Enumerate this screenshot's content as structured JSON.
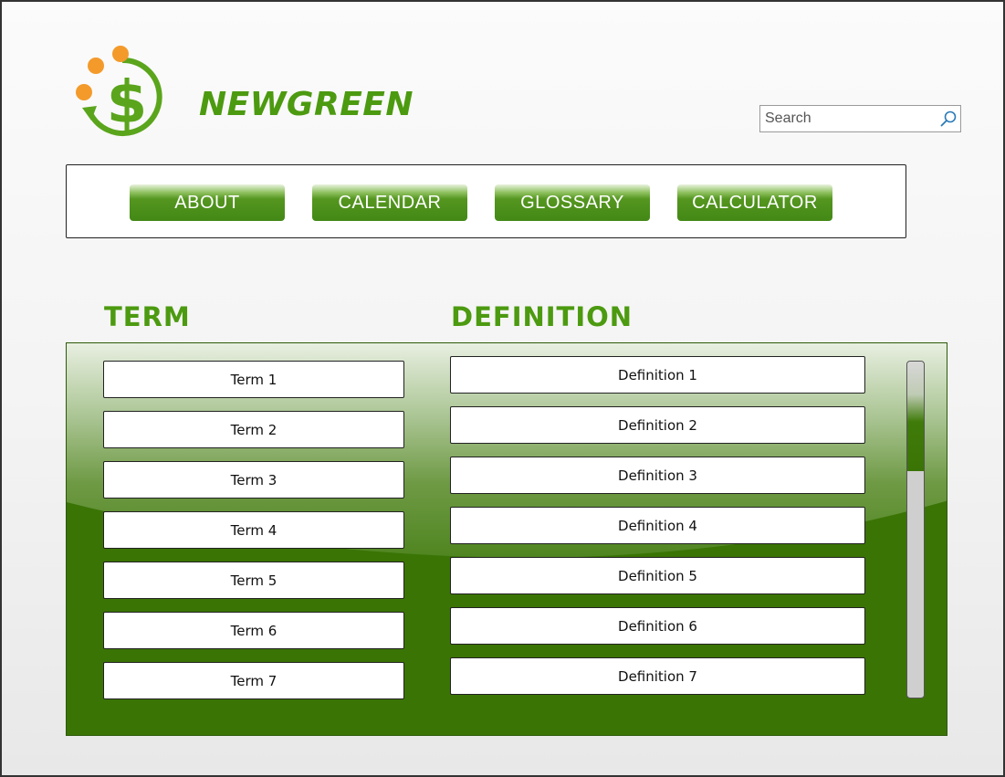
{
  "brand": {
    "name": "NEWGREEN"
  },
  "search": {
    "placeholder": "Search"
  },
  "nav": {
    "items": [
      {
        "label": "ABOUT"
      },
      {
        "label": "CALENDAR"
      },
      {
        "label": "GLOSSARY"
      },
      {
        "label": "CALCULATOR"
      }
    ]
  },
  "glossary": {
    "term_heading": "TERM",
    "definition_heading": "DEFINITION",
    "terms": [
      "Term 1",
      "Term 2",
      "Term 3",
      "Term 4",
      "Term 5",
      "Term 6",
      "Term 7"
    ],
    "definitions": [
      "Definition 1",
      "Definition 2",
      "Definition 3",
      "Definition 4",
      "Definition 5",
      "Definition 6",
      "Definition 7"
    ]
  },
  "colors": {
    "brand_green": "#4c9a10",
    "panel_green": "#3a7405",
    "accent_orange": "#f39a2b"
  },
  "icons": {
    "logo": "dollar-cycle-icon",
    "search": "magnifier-icon"
  }
}
